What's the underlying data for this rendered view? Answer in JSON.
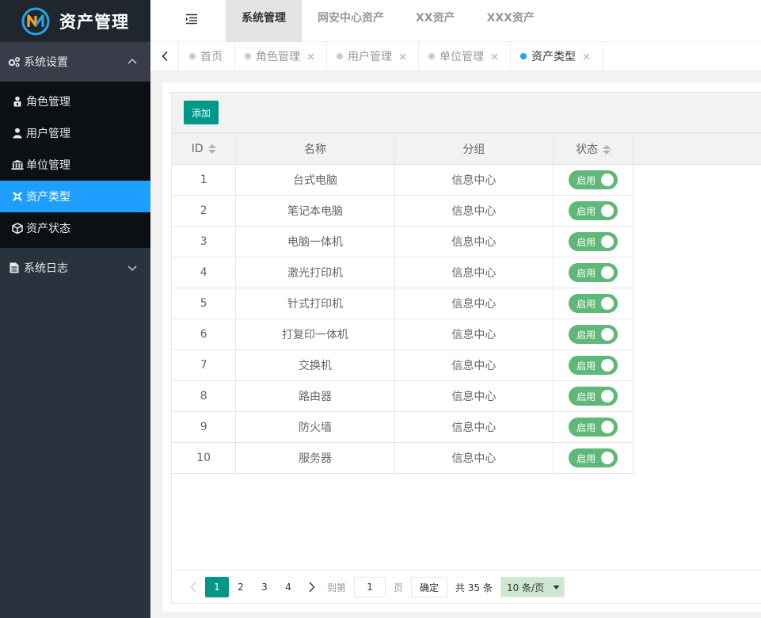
{
  "app": {
    "title": "资产管理"
  },
  "sidebar": {
    "groups": [
      {
        "label": "系统设置",
        "icon": "gears-icon",
        "expanded": true
      },
      {
        "label": "系统日志",
        "icon": "file-text-icon",
        "expanded": false
      }
    ],
    "items": [
      {
        "label": "角色管理",
        "icon": "user-lock-icon"
      },
      {
        "label": "用户管理",
        "icon": "user-icon"
      },
      {
        "label": "单位管理",
        "icon": "institution-icon"
      },
      {
        "label": "资产类型",
        "icon": "asterisk-icon",
        "active": true
      },
      {
        "label": "资产状态",
        "icon": "cube-icon"
      }
    ]
  },
  "header": {
    "nav": [
      {
        "label": "系统管理",
        "active": true
      },
      {
        "label": "网安中心资产"
      },
      {
        "label": "XX资产"
      },
      {
        "label": "XXX资产"
      }
    ]
  },
  "tabs": [
    {
      "label": "首页",
      "closable": false
    },
    {
      "label": "角色管理",
      "closable": true
    },
    {
      "label": "用户管理",
      "closable": true
    },
    {
      "label": "单位管理",
      "closable": true
    },
    {
      "label": "资产类型",
      "closable": true,
      "active": true
    }
  ],
  "toolbar": {
    "add_label": "添加"
  },
  "table": {
    "columns": [
      "ID",
      "名称",
      "分组",
      "状态"
    ],
    "rows": [
      {
        "id": "1",
        "name": "台式电脑",
        "group": "信息中心",
        "status": "启用"
      },
      {
        "id": "2",
        "name": "笔记本电脑",
        "group": "信息中心",
        "status": "启用"
      },
      {
        "id": "3",
        "name": "电脑一体机",
        "group": "信息中心",
        "status": "启用"
      },
      {
        "id": "4",
        "name": "激光打印机",
        "group": "信息中心",
        "status": "启用"
      },
      {
        "id": "5",
        "name": "针式打印机",
        "group": "信息中心",
        "status": "启用"
      },
      {
        "id": "6",
        "name": "打复印一体机",
        "group": "信息中心",
        "status": "启用"
      },
      {
        "id": "7",
        "name": "交换机",
        "group": "信息中心",
        "status": "启用"
      },
      {
        "id": "8",
        "name": "路由器",
        "group": "信息中心",
        "status": "启用"
      },
      {
        "id": "9",
        "name": "防火墙",
        "group": "信息中心",
        "status": "启用"
      },
      {
        "id": "10",
        "name": "服务器",
        "group": "信息中心",
        "status": "启用"
      }
    ]
  },
  "pager": {
    "pages": [
      "1",
      "2",
      "3",
      "4"
    ],
    "current": "1",
    "skip_label": "到第",
    "skip_value": "1",
    "page_unit": "页",
    "confirm_label": "确定",
    "total_text": "共 35 条",
    "limit_text": "10 条/页"
  },
  "colors": {
    "sidebar_bg": "#28333e",
    "active_blue": "#1e9fff",
    "primary_teal": "#009688",
    "switch_green": "#5fb878"
  }
}
